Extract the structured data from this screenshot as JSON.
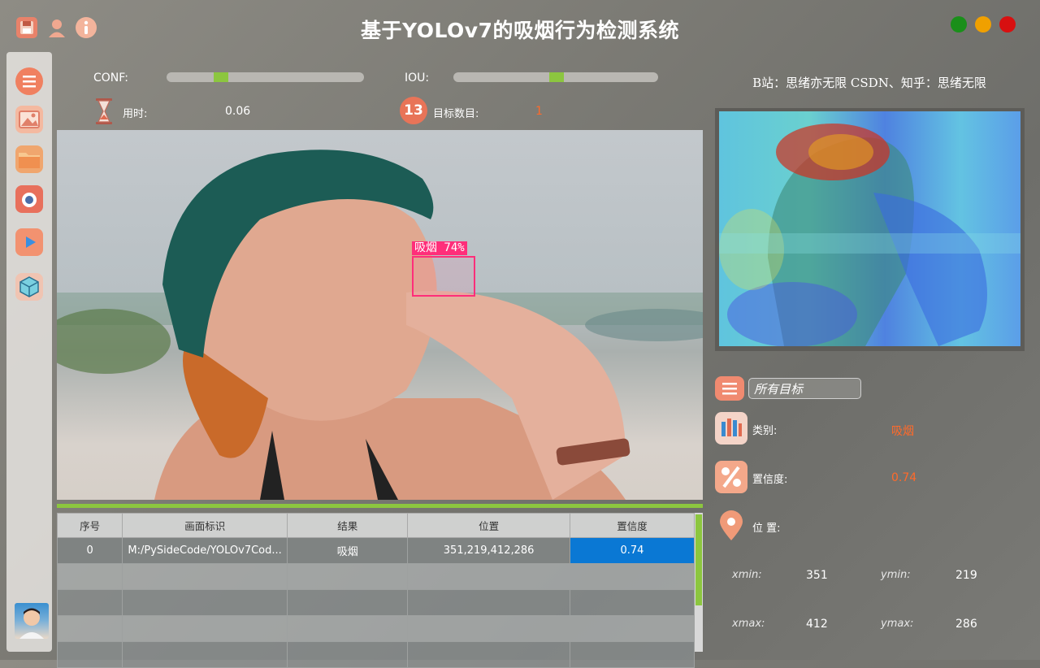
{
  "app": {
    "title": "基于YOLOv7的吸烟行为检测系统",
    "credit": "B站：思绪亦无限  CSDN、知乎：思绪无限"
  },
  "toolbar_icons": [
    "save-icon",
    "user-icon",
    "info-icon"
  ],
  "window_buttons": {
    "maximize_color": "#1a8f1a",
    "minimize_color": "#f0a000",
    "close_color": "#d81010"
  },
  "sidebar": {
    "items": [
      "menu-icon",
      "image-icon",
      "folder-icon",
      "camera-icon",
      "video-play-icon",
      "model-cube-icon"
    ],
    "avatar": "user-avatar"
  },
  "controls": {
    "conf_label": "CONF:",
    "conf_value": 0.3,
    "iou_label": "IOU:",
    "iou_value": 0.6,
    "time_label": "用时:",
    "time_value": "0.06",
    "count_label": "目标数目:",
    "count_value": "1",
    "count_badge": "13"
  },
  "detection": {
    "box_label": "吸烟 74%",
    "box_color": "#ff2e7a"
  },
  "table": {
    "headers": [
      "序号",
      "画面标识",
      "结果",
      "位置",
      "置信度"
    ],
    "rows": [
      [
        "0",
        "M:/PySideCode/YOLOv7Cod...",
        "吸烟",
        "351,219,412,286",
        "0.74"
      ]
    ],
    "empty_rows": 4
  },
  "details": {
    "target_select": "所有目标",
    "class_label": "类别:",
    "class_value": "吸烟",
    "conf_label": "置信度:",
    "conf_value": "0.74",
    "position_label": "位 置:",
    "xmin_label": "xmin:",
    "xmin_value": "351",
    "ymin_label": "ymin:",
    "ymin_value": "219",
    "xmax_label": "xmax:",
    "xmax_value": "412",
    "ymax_label": "ymax:",
    "ymax_value": "286"
  },
  "colors": {
    "accent_green": "#8cc63f",
    "selected_cell": "#0a78d4",
    "value_orange": "#ff6a2a"
  }
}
